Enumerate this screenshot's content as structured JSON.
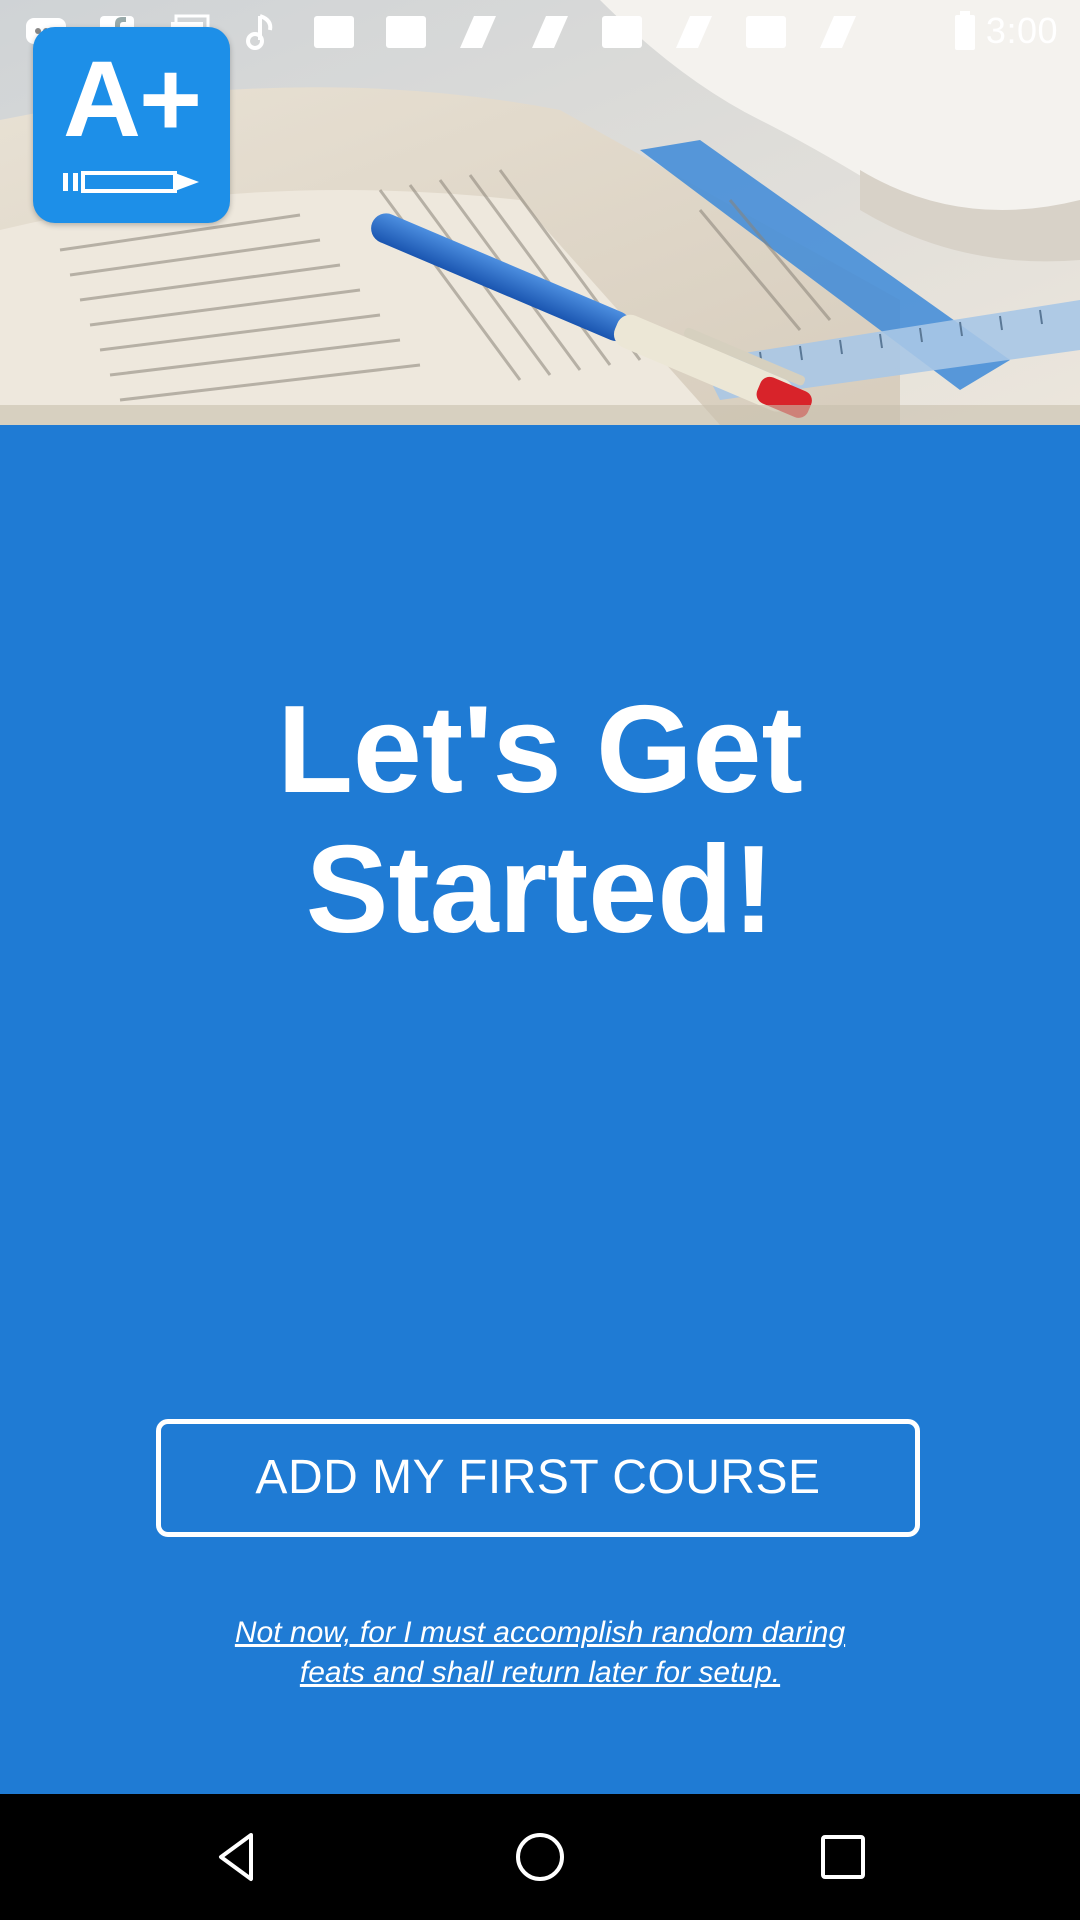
{
  "status_bar": {
    "time": "3:00",
    "icons": [
      "messenger-icon",
      "facebook-icon",
      "news-icon",
      "music-icon",
      "app-icon",
      "app-icon",
      "app-icon",
      "app-icon",
      "app-icon",
      "app-icon",
      "app-icon",
      "app-icon",
      "signal-icon"
    ]
  },
  "app": {
    "logo_text": "A+",
    "logo_icon": "pencil-icon"
  },
  "main": {
    "title_line1": "Let's Get",
    "title_line2": "Started!",
    "primary_button_label": "ADD MY FIRST COURSE",
    "skip_link_line1": "Not now, for I must accomplish random daring",
    "skip_link_line2": "feats and shall return later for setup."
  },
  "nav": {
    "back": "back-icon",
    "home": "home-icon",
    "recent": "recent-apps-icon"
  },
  "colors": {
    "brand_blue": "#1f7bd4",
    "logo_blue": "#1d8fe8",
    "text": "#ffffff",
    "nav_bar": "#000000"
  }
}
